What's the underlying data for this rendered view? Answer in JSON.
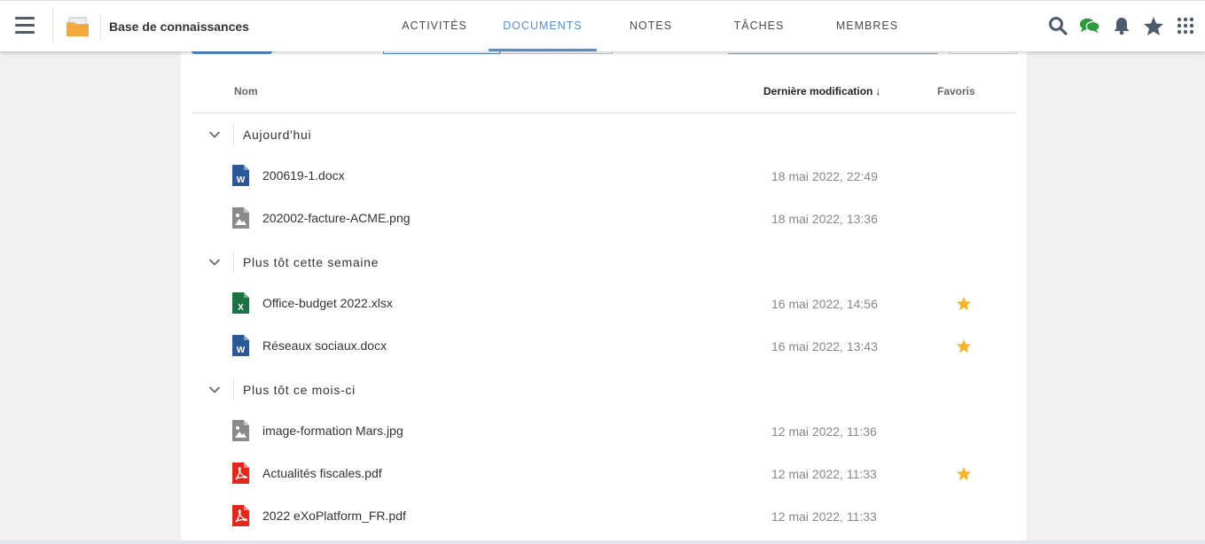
{
  "header": {
    "space_title": "Base de connaissances",
    "tabs": [
      {
        "label": "ACTIVITÉS",
        "active": false
      },
      {
        "label": "DOCUMENTS",
        "active": true
      },
      {
        "label": "NOTES",
        "active": false
      },
      {
        "label": "TÂCHES",
        "active": false
      },
      {
        "label": "MEMBRES",
        "active": false
      }
    ],
    "right_icons": [
      "search-icon",
      "chat-icon",
      "bell-icon",
      "star-icon",
      "apps-grid-icon"
    ]
  },
  "colors": {
    "accent": "#578dc9",
    "icon_gray": "#4e5d6e",
    "chat_green": "#2f9a3c",
    "favorite_star": "#f6b52b",
    "word_blue": "#2b5797",
    "excel_green": "#1e7145",
    "pdf_red": "#e0281c",
    "image_gray": "#8a8a8a"
  },
  "table": {
    "col_name": "Nom",
    "col_modified": "Dernière modification",
    "col_modified_sort": "↓",
    "col_favorites": "Favoris"
  },
  "groups": [
    {
      "label": "Aujourd'hui",
      "files": [
        {
          "name": "200619-1.docx",
          "date": "18 mai 2022, 22:49",
          "type": "word",
          "favorite": false
        },
        {
          "name": "202002-facture-ACME.png",
          "date": "18 mai 2022, 13:36",
          "type": "image",
          "favorite": false
        }
      ]
    },
    {
      "label": "Plus tôt cette semaine",
      "files": [
        {
          "name": "Office-budget 2022.xlsx",
          "date": "16 mai 2022, 14:56",
          "type": "excel",
          "favorite": true
        },
        {
          "name": "Réseaux sociaux.docx",
          "date": "16 mai 2022, 13:43",
          "type": "word",
          "favorite": true
        }
      ]
    },
    {
      "label": "Plus tôt ce mois-ci",
      "files": [
        {
          "name": "image-formation Mars.jpg",
          "date": "12 mai 2022, 11:36",
          "type": "image",
          "favorite": false
        },
        {
          "name": "Actualités fiscales.pdf",
          "date": "12 mai 2022, 11:33",
          "type": "pdf",
          "favorite": true
        },
        {
          "name": "2022 eXoPlatform_FR.pdf",
          "date": "12 mai 2022, 11:33",
          "type": "pdf",
          "favorite": false
        }
      ]
    }
  ]
}
